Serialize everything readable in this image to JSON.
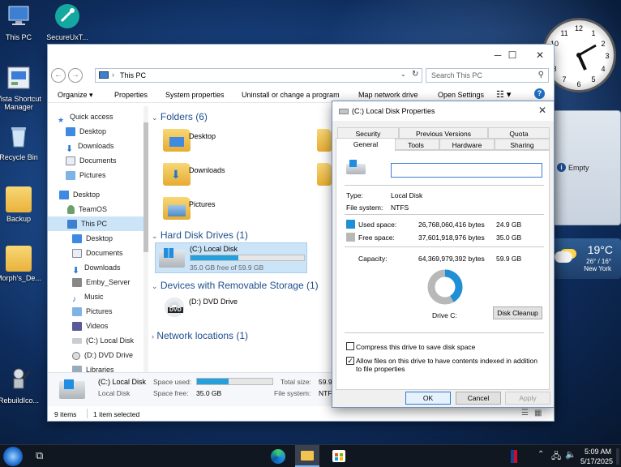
{
  "desktop_icons": [
    {
      "label": "This PC"
    },
    {
      "label": "SecureUxT..."
    },
    {
      "label": "Vista Shortcut Manager"
    },
    {
      "label": "Recycle Bin"
    },
    {
      "label": "Backup"
    },
    {
      "label": "Morph's_De..."
    },
    {
      "label": "RebuildIco..."
    }
  ],
  "explorer": {
    "address": "This PC",
    "search_placeholder": "Search This PC",
    "toolbar": [
      "Organize",
      "Properties",
      "System properties",
      "Uninstall or change a program",
      "Map network drive",
      "Open Settings"
    ],
    "nav": [
      {
        "label": "Quick access"
      },
      {
        "label": "Desktop"
      },
      {
        "label": "Downloads"
      },
      {
        "label": "Documents"
      },
      {
        "label": "Pictures"
      },
      {
        "label": "Desktop"
      },
      {
        "label": "TeamOS"
      },
      {
        "label": "This PC"
      },
      {
        "label": "Desktop"
      },
      {
        "label": "Documents"
      },
      {
        "label": "Downloads"
      },
      {
        "label": "Emby_Server"
      },
      {
        "label": "Music"
      },
      {
        "label": "Pictures"
      },
      {
        "label": "Videos"
      },
      {
        "label": "(C:) Local Disk"
      },
      {
        "label": "(D:) DVD Drive"
      },
      {
        "label": "Libraries"
      }
    ],
    "folders_header": "Folders (6)",
    "folders": [
      {
        "label": "Desktop"
      },
      {
        "label": "Downloads"
      },
      {
        "label": "Pictures"
      }
    ],
    "drives_header": "Hard Disk Drives (1)",
    "drive": {
      "name": "(C:) Local Disk",
      "free_text": "35.0 GB free of 59.9 GB",
      "used_fraction": 0.42
    },
    "removable_header": "Devices with Removable Storage (1)",
    "dvd": {
      "name": "(D:) DVD Drive",
      "badge": "DVD"
    },
    "network_header": "Network locations (1)",
    "details": {
      "name": "(C:) Local Disk",
      "type": "Local Disk",
      "space_used_label": "Space used:",
      "space_free_label": "Space free:",
      "space_free": "35.0 GB",
      "total_size_label": "Total size:",
      "total_size": "59.9",
      "fs_label": "File system:",
      "fs": "NTFS",
      "used_fraction": 0.42
    },
    "status": {
      "items": "9 items",
      "selected": "1 item selected"
    }
  },
  "props": {
    "title": "(C:) Local Disk Properties",
    "tabs_back": [
      "Security",
      "Previous Versions",
      "Quota"
    ],
    "tabs_front": [
      "General",
      "Tools",
      "Hardware",
      "Sharing"
    ],
    "name_value": "",
    "type_label": "Type:",
    "type": "Local Disk",
    "fs_label": "File system:",
    "fs": "NTFS",
    "used_label": "Used space:",
    "used_bytes": "26,768,060,416 bytes",
    "used_gb": "24.9 GB",
    "free_label": "Free space:",
    "free_bytes": "37,601,918,976 bytes",
    "free_gb": "35.0 GB",
    "cap_label": "Capacity:",
    "cap_bytes": "64,369,979,392 bytes",
    "cap_gb": "59.9 GB",
    "used_fraction": 0.416,
    "drive_label": "Drive C:",
    "cleanup": "Disk Cleanup",
    "compress": "Compress this drive to save disk space",
    "index": "Allow files on this drive to have contents indexed in addition to file properties",
    "ok": "OK",
    "cancel": "Cancel",
    "apply": "Apply",
    "colors": {
      "used": "#1f8fd6",
      "free": "#b8b8b8"
    }
  },
  "gadgets": {
    "clock_numbers": [
      "12",
      "1",
      "2",
      "3",
      "4",
      "5",
      "6",
      "7",
      "8",
      "9",
      "10",
      "11"
    ],
    "empty_label": "Empty",
    "weather": {
      "temp": "19°C",
      "range": "26° / 16°",
      "city": "New York"
    }
  },
  "taskbar": {
    "time": "5:09 AM",
    "date": "5/17/2025"
  }
}
